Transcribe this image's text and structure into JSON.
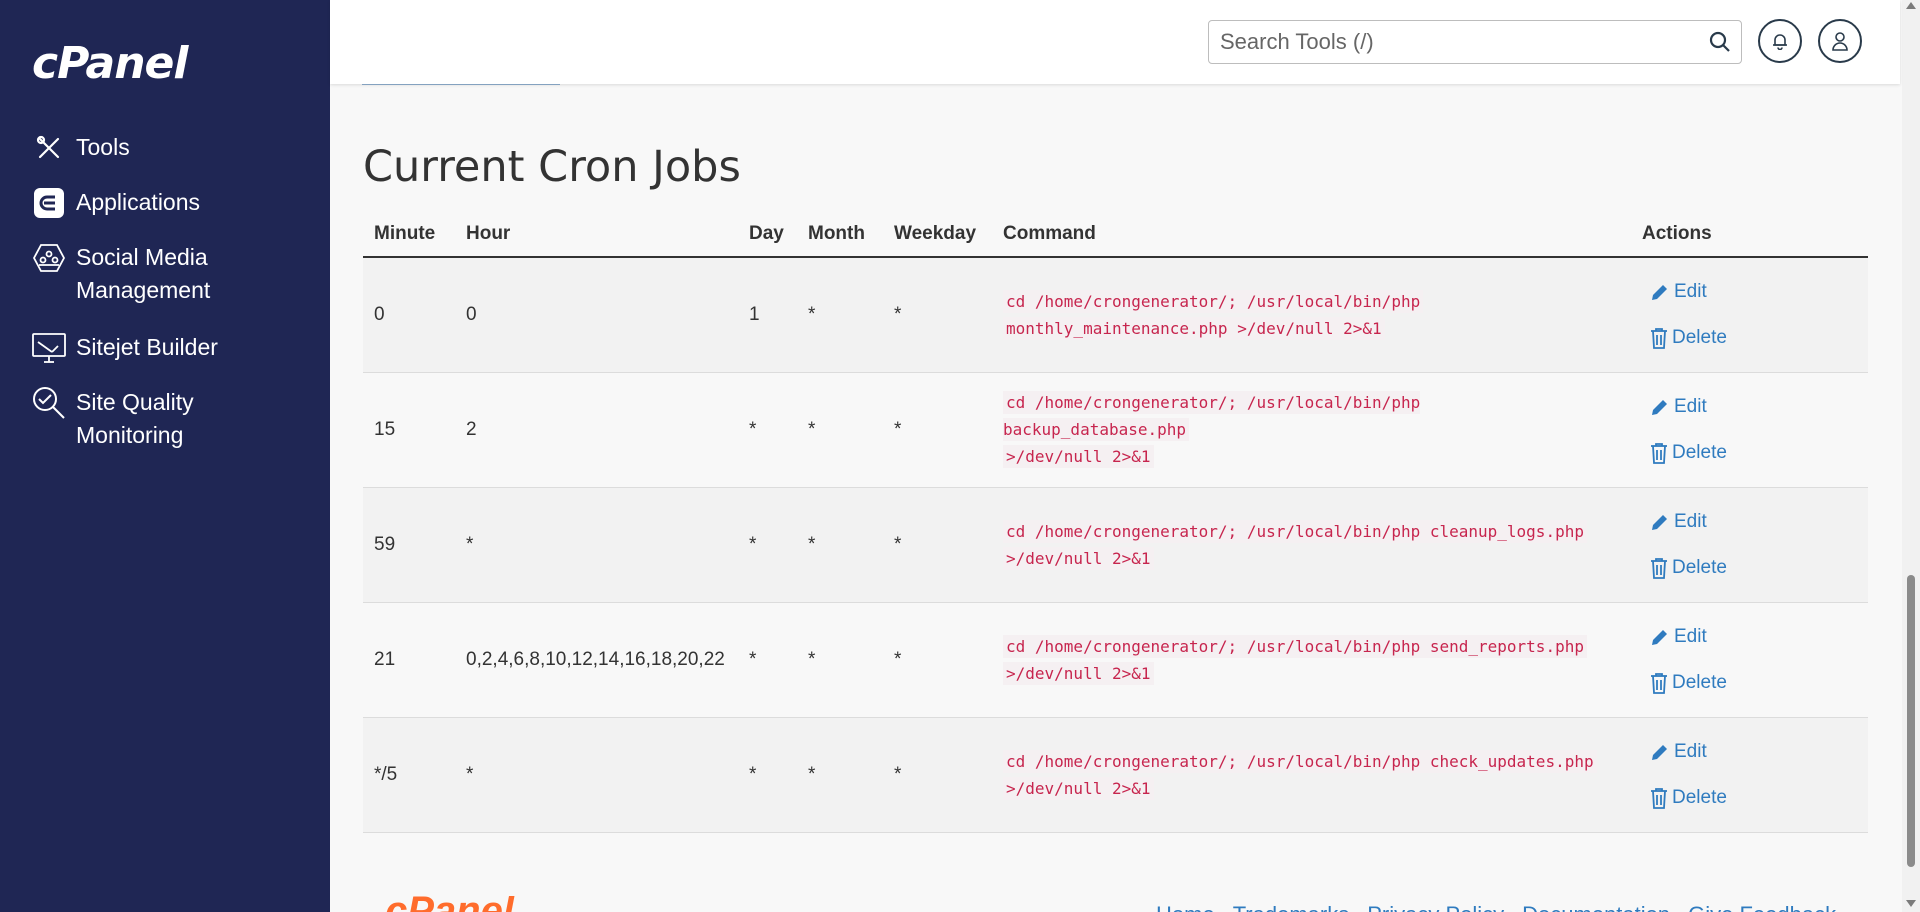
{
  "brand": {
    "logo_text": "cPanel"
  },
  "sidebar": {
    "items": [
      {
        "label": "Tools",
        "icon": "tools-icon"
      },
      {
        "label": "Applications",
        "icon": "applications-icon"
      },
      {
        "label": "Social Media Management",
        "icon": "social-media-icon"
      },
      {
        "label": "Sitejet Builder",
        "icon": "sitejet-icon"
      },
      {
        "label": "Site Quality Monitoring",
        "icon": "site-quality-icon"
      }
    ]
  },
  "header": {
    "search_placeholder": "Search Tools (/)",
    "notifications_icon": "bell-icon",
    "user_icon": "user-icon"
  },
  "main": {
    "title": "Current Cron Jobs",
    "columns": [
      "Minute",
      "Hour",
      "Day",
      "Month",
      "Weekday",
      "Command",
      "Actions"
    ],
    "rows": [
      {
        "minute": "0",
        "hour": "0",
        "day": "1",
        "month": "*",
        "weekday": "*",
        "cmd1": "cd /home/crongenerator/; /usr/local/bin/php",
        "cmd2": "monthly_maintenance.php >/dev/null 2>&1",
        "edit": "Edit",
        "delete": "Delete"
      },
      {
        "minute": "15",
        "hour": "2",
        "day": "*",
        "month": "*",
        "weekday": "*",
        "cmd1": "cd /home/crongenerator/; /usr/local/bin/php backup_database.php",
        "cmd2": ">/dev/null 2>&1",
        "edit": "Edit",
        "delete": "Delete"
      },
      {
        "minute": "59",
        "hour": "*",
        "day": "*",
        "month": "*",
        "weekday": "*",
        "cmd1": "cd /home/crongenerator/; /usr/local/bin/php cleanup_logs.php",
        "cmd2": ">/dev/null 2>&1",
        "edit": "Edit",
        "delete": "Delete"
      },
      {
        "minute": "21",
        "hour": "0,2,4,6,8,10,12,14,16,18,20,22",
        "day": "*",
        "month": "*",
        "weekday": "*",
        "cmd1": "cd /home/crongenerator/; /usr/local/bin/php send_reports.php",
        "cmd2": ">/dev/null 2>&1",
        "edit": "Edit",
        "delete": "Delete"
      },
      {
        "minute": "*/5",
        "hour": "*",
        "day": "*",
        "month": "*",
        "weekday": "*",
        "cmd1": "cd /home/crongenerator/; /usr/local/bin/php check_updates.php",
        "cmd2": ">/dev/null 2>&1",
        "edit": "Edit",
        "delete": "Delete"
      }
    ]
  },
  "footer": {
    "logo_text": "cPanel",
    "links": [
      "Home",
      "Trademarks",
      "Privacy Policy",
      "Documentation",
      "Give Feedback"
    ]
  },
  "colors": {
    "sidebar_bg": "#1f2654",
    "link": "#2f7bbf",
    "command_text": "#c7254e",
    "footer_brand": "#ff6c2c"
  }
}
